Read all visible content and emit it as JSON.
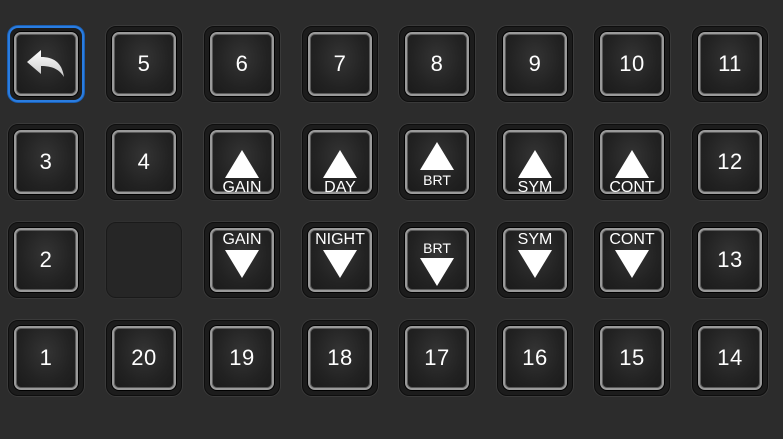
{
  "keys": {
    "back": "back-arrow-icon",
    "k5": "5",
    "k6": "6",
    "k7": "7",
    "k8": "8",
    "k9": "9",
    "k10": "10",
    "k11": "11",
    "k3": "3",
    "k4": "4",
    "k12": "12",
    "k2": "2",
    "k13": "13",
    "k1": "1",
    "k20": "20",
    "k19": "19",
    "k18": "18",
    "k17": "17",
    "k16": "16",
    "k15": "15",
    "k14": "14",
    "gain_up": "GAIN",
    "day_up": "DAY",
    "brt_up": "BRT",
    "sym_up": "SYM",
    "cont_up": "CONT",
    "gain_down": "GAIN",
    "night_down": "NIGHT",
    "brt_down": "BRT",
    "sym_down": "SYM",
    "cont_down": "CONT"
  },
  "colors": {
    "background": "#2c2c2c",
    "selection": "#2a7de1",
    "text": "#ffffff"
  }
}
